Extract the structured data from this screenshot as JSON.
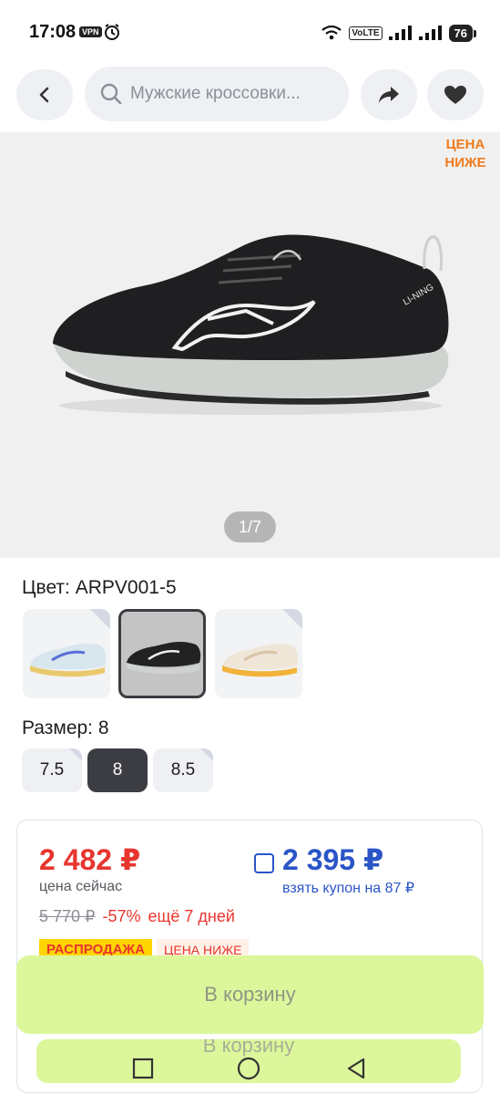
{
  "status_bar": {
    "time": "17:08",
    "vpn": "VPN",
    "volte": "VoLTE",
    "battery": "76"
  },
  "header": {
    "search_text": "Мужские кроссовки..."
  },
  "gallery": {
    "sticker_line1": "ЦЕНА",
    "sticker_line2": "НИЖЕ",
    "counter": "1/7"
  },
  "color": {
    "title": "Цвет: ARPV001-5"
  },
  "size": {
    "title": "Размер: 8",
    "options": [
      "7.5",
      "8",
      "8.5"
    ],
    "selected": "8"
  },
  "price": {
    "now": "2 482 ₽",
    "now_caption": "цена сейчас",
    "coupon_price": "2 395 ₽",
    "coupon_caption": "взять купон на 87 ₽",
    "old_price": "5 770 ₽",
    "discount": "-57%",
    "days_left": "ещё 7 дней",
    "badge_sale": "РАСПРОДАЖА",
    "badge_lower": "ЦЕНА НИЖЕ"
  },
  "cart": {
    "label": "В корзину",
    "ghost_label": "В корзину"
  },
  "colors": {
    "accent_red": "#e8352e",
    "coupon_blue": "#2b55c7",
    "cart_green": "#dcf79b"
  }
}
